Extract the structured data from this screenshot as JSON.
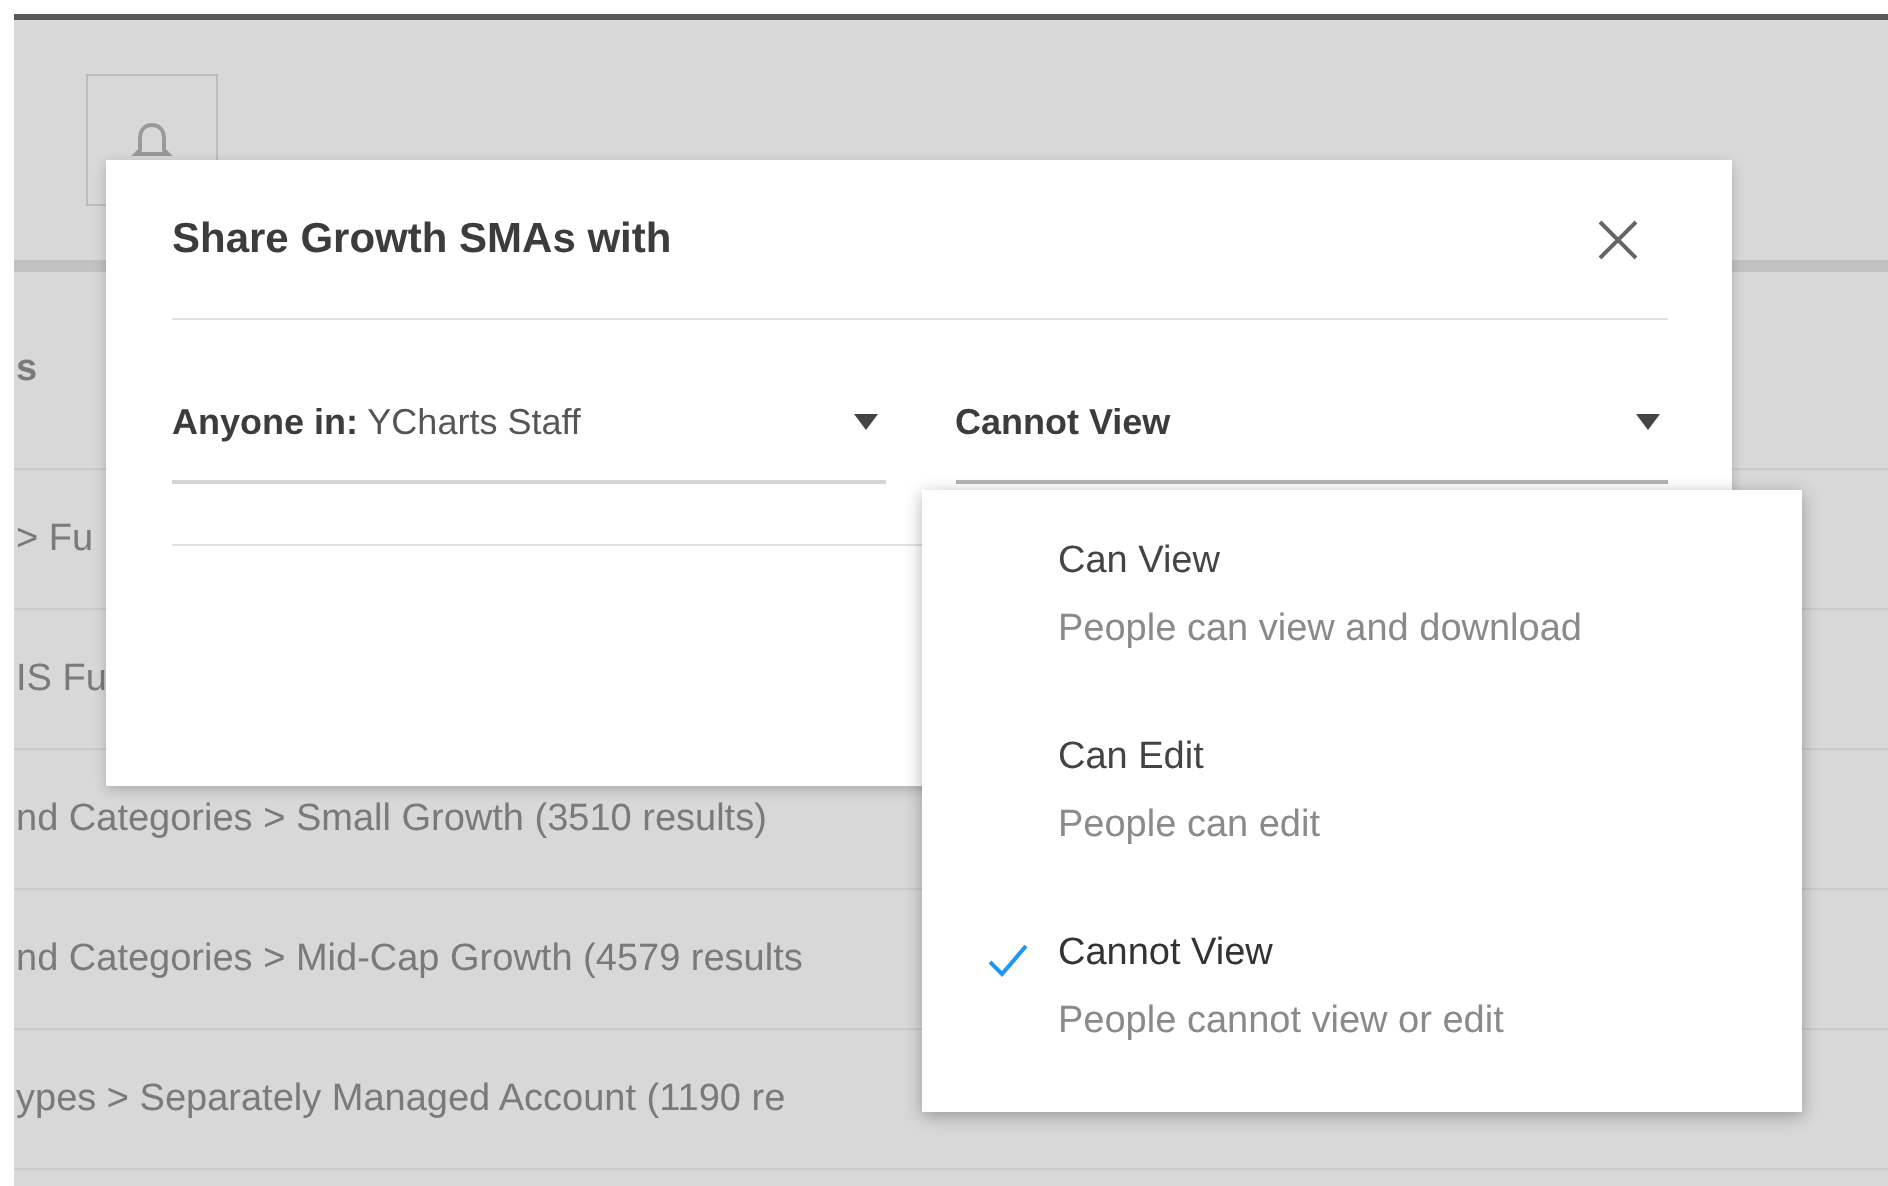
{
  "background_table": {
    "header": "s",
    "rows": [
      "> Fu",
      "IS Fu",
      "nd Categories > Small Growth (3510 results)",
      "nd Categories > Mid-Cap Growth (4579 results",
      "ypes > Separately Managed Account (1190 re"
    ]
  },
  "dialog": {
    "title": "Share Growth SMAs with",
    "audience_select": {
      "text": "**Anyone in:** YCharts Staff"
    },
    "permission_select": {
      "value": "Cannot View",
      "expanded": true
    },
    "permission_menu": [
      {
        "title": "Can View",
        "description": "People can view and download",
        "selected": false
      },
      {
        "title": "Can Edit",
        "description": "People can edit",
        "selected": false
      },
      {
        "title": "Cannot View",
        "description": "People cannot view or edit",
        "selected": true
      }
    ]
  }
}
